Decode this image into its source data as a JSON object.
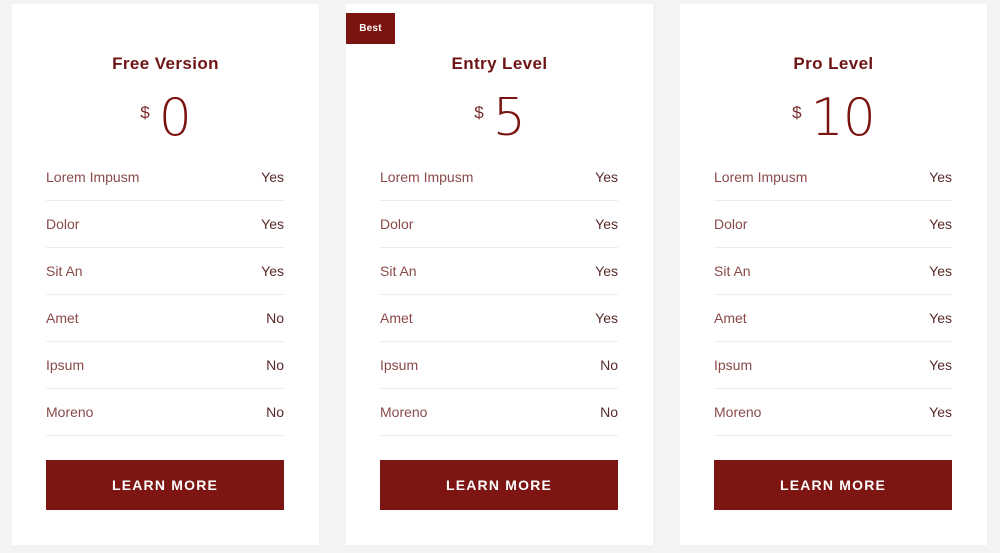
{
  "plans": [
    {
      "title": "Free Version",
      "currency": "$",
      "price": "0",
      "features": [
        {
          "label": "Lorem Impusm",
          "value": "Yes"
        },
        {
          "label": "Dolor",
          "value": "Yes"
        },
        {
          "label": "Sit An",
          "value": "Yes"
        },
        {
          "label": "Amet",
          "value": "No"
        },
        {
          "label": "Ipsum",
          "value": "No"
        },
        {
          "label": "Moreno",
          "value": "No"
        }
      ],
      "button_label": "LEARN MORE"
    },
    {
      "badge": "Best",
      "title": "Entry Level",
      "currency": "$",
      "price": "5",
      "features": [
        {
          "label": "Lorem Impusm",
          "value": "Yes"
        },
        {
          "label": "Dolor",
          "value": "Yes"
        },
        {
          "label": "Sit An",
          "value": "Yes"
        },
        {
          "label": "Amet",
          "value": "Yes"
        },
        {
          "label": "Ipsum",
          "value": "No"
        },
        {
          "label": "Moreno",
          "value": "No"
        }
      ],
      "button_label": "LEARN MORE"
    },
    {
      "title": "Pro Level",
      "currency": "$",
      "price": "10",
      "features": [
        {
          "label": "Lorem Impusm",
          "value": "Yes"
        },
        {
          "label": "Dolor",
          "value": "Yes"
        },
        {
          "label": "Sit An",
          "value": "Yes"
        },
        {
          "label": "Amet",
          "value": "Yes"
        },
        {
          "label": "Ipsum",
          "value": "Yes"
        },
        {
          "label": "Moreno",
          "value": "Yes"
        }
      ],
      "button_label": "LEARN MORE"
    }
  ],
  "colors": {
    "accent": "#7b1410",
    "background": "#f3f3f3",
    "card": "#ffffff"
  }
}
